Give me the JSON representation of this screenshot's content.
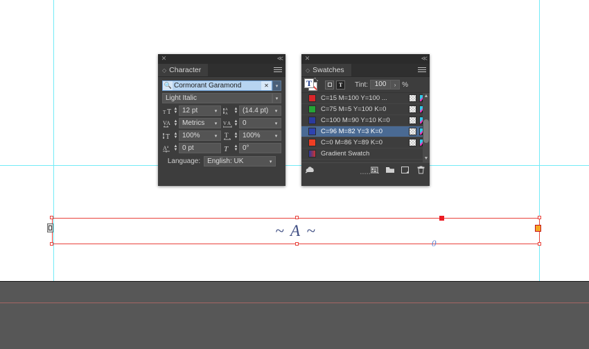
{
  "app": {
    "canvas_bg": "#ffffff",
    "pasteboard_color": "#575757",
    "guide_color": "#72eaf7",
    "frame_color": "#e8413a"
  },
  "document": {
    "text_frame": {
      "content": "~ A ~",
      "text_color": "#3b4a80",
      "baseline_marker": "0",
      "in_port_icon": "text-in-port-icon",
      "out_port_icon": "text-out-port-overset-icon"
    }
  },
  "character_panel": {
    "title": "Character",
    "close_icon": "✕",
    "collapse_icon": "≪",
    "menu_icon": "panel-menu-icon",
    "font_family": {
      "value": "Cormorant Garamond",
      "search_icon": "font-search-icon",
      "clear_icon": "✕"
    },
    "font_style": {
      "value": "Light Italic"
    },
    "fields": [
      {
        "icon": "font-size-icon",
        "label": "Font Size",
        "value": "12 pt"
      },
      {
        "icon": "leading-icon",
        "label": "Leading",
        "value": "(14.4 pt)"
      },
      {
        "icon": "kerning-icon",
        "label": "Kerning",
        "value": "Metrics"
      },
      {
        "icon": "tracking-icon",
        "label": "Tracking",
        "value": "0"
      },
      {
        "icon": "vertical-scale-icon",
        "label": "Vertical Scale",
        "value": "100%"
      },
      {
        "icon": "horizontal-scale-icon",
        "label": "Horizontal Scale",
        "value": "100%"
      },
      {
        "icon": "baseline-shift-icon",
        "label": "Baseline Shift",
        "value": "0 pt"
      },
      {
        "icon": "skew-icon",
        "label": "Skew",
        "value": "0°"
      }
    ],
    "language": {
      "label": "Language:",
      "value": "English: UK"
    }
  },
  "swatches_panel": {
    "title": "Swatches",
    "close_icon": "✕",
    "collapse_icon": "≪",
    "menu_icon": "panel-menu-icon",
    "toolbar": {
      "fill_stroke_icon": "fill-stroke-text-icon",
      "swap_icon": "swap-fill-stroke-icon",
      "formatting_container_label": "□",
      "formatting_text_label": "T",
      "tint_label": "Tint:",
      "tint_value": "100",
      "tint_arrow": "›",
      "percent": "%"
    },
    "rows": [
      {
        "name": "C=15 M=100 Y=100 ...",
        "color": "#d9252a",
        "selected": false,
        "icons": [
          "process-color-icon",
          "cmyk-mode-icon"
        ]
      },
      {
        "name": "C=75 M=5 Y=100 K=0",
        "color": "#25a436",
        "selected": false,
        "icons": [
          "process-color-icon",
          "cmyk-mode-icon"
        ]
      },
      {
        "name": "C=100 M=90 Y=10 K=0",
        "color": "#2b3a9e",
        "selected": false,
        "icons": [
          "process-color-icon",
          "cmyk-mode-icon"
        ]
      },
      {
        "name": "C=96 M=82 Y=3 K=0",
        "color": "#2e43b0",
        "selected": true,
        "icons": [
          "process-color-icon",
          "cmyk-mode-icon"
        ]
      },
      {
        "name": "C=0 M=86 Y=89 K=0",
        "color": "#ef3e23",
        "selected": false,
        "icons": [
          "process-color-icon",
          "cmyk-mode-icon"
        ]
      },
      {
        "name": "Gradient Swatch",
        "color": "#2b3a9e",
        "selected": false,
        "icons": []
      }
    ],
    "scrollbar": {
      "up_icon": "▲",
      "down_icon": "▼"
    },
    "footer_icons": [
      "show-all-swatches-icon",
      "new-color-group-icon",
      "new-swatch-folder-icon",
      "new-swatch-icon",
      "delete-swatch-icon"
    ]
  }
}
